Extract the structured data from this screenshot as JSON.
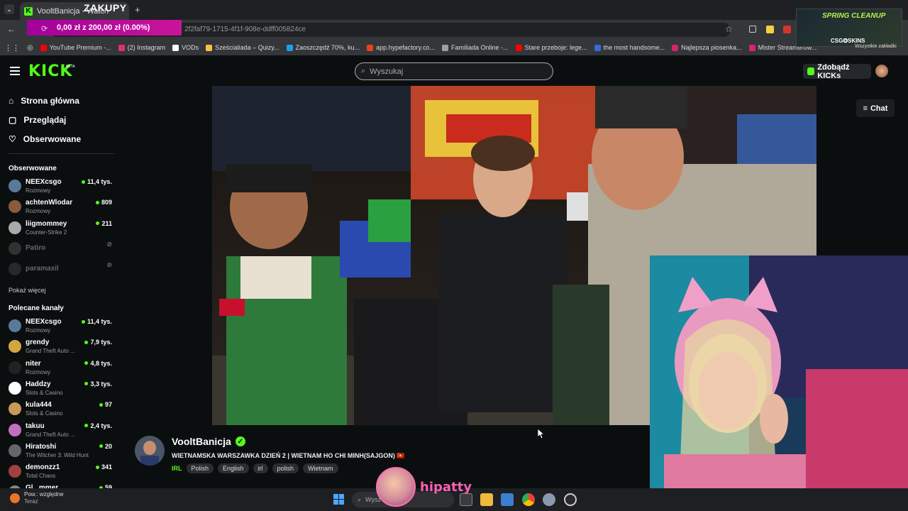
{
  "browser": {
    "tab_title": "VooltBanicja - Watch",
    "tab_overlay": "ZAKUPY",
    "url": "2f2faf79-1715-4f1f-908e-ddff005824ce",
    "donation": "0,00 zł z 200,00 zł (0.00%)",
    "bookmarks": [
      {
        "label": "YouTube Premium -...",
        "color": "#ff0000"
      },
      {
        "label": "(2) Instagram",
        "color": "#e1306c"
      },
      {
        "label": "VODs",
        "color": "#ffffff"
      },
      {
        "label": "Sześcialiada – Quizy...",
        "color": "#f5c542"
      },
      {
        "label": "Zaoszczędź 70%, ku...",
        "color": "#1b9fe8"
      },
      {
        "label": "app.hypefactory.co...",
        "color": "#e8421b"
      },
      {
        "label": "Familiada Online -...",
        "color": "#9aa0a6"
      },
      {
        "label": "Stare przeboje: lege...",
        "color": "#ff0000"
      },
      {
        "label": "the most handsome...",
        "color": "#2f6fd6"
      },
      {
        "label": "Najlepsza piosenka...",
        "color": "#d6246e"
      },
      {
        "label": "Mister Streamerów...",
        "color": "#d6246e"
      }
    ],
    "ad": {
      "line1": "SPRING CLEANUP",
      "line2": "CSG✪SKINS",
      "all_bookmarks": "Wszystkie zakładki"
    }
  },
  "kick": {
    "logo": "KICK",
    "logo_beta": "BETA",
    "search_placeholder": "Wyszukaj",
    "get_kicks": "Zdobądź KICKs",
    "chat_label": "Chat"
  },
  "sidebar": {
    "nav": [
      {
        "label": "Strona główna",
        "icon": "home-icon"
      },
      {
        "label": "Przeglądaj",
        "icon": "browse-icon"
      },
      {
        "label": "Obserwowane",
        "icon": "heart-icon"
      }
    ],
    "followed_title": "Obserwowane",
    "followed": [
      {
        "name": "NEEXcsgo",
        "category": "Rozmowy",
        "viewers": "11,4 tys.",
        "live": true,
        "color": "#5a7a9a"
      },
      {
        "name": "achtenWlodar",
        "category": "Rozmowy",
        "viewers": "809",
        "live": true,
        "color": "#8a5a3a"
      },
      {
        "name": "liigmommey",
        "category": "Counter-Strike 2",
        "viewers": "211",
        "live": true,
        "color": "#aaaaaa"
      },
      {
        "name": "Patiro",
        "category": "",
        "viewers": "",
        "live": false,
        "color": "#555555"
      },
      {
        "name": "paramaxil",
        "category": "",
        "viewers": "",
        "live": false,
        "color": "#444444"
      }
    ],
    "show_more": "Pokaż więcej",
    "recommended_title": "Polecane kanały",
    "recommended": [
      {
        "name": "NEEXcsgo",
        "category": "Rozmowy",
        "viewers": "11,4 tys.",
        "color": "#5a7a9a"
      },
      {
        "name": "grendy",
        "category": "Grand Theft Auto ...",
        "viewers": "7,9 tys.",
        "color": "#d4a640"
      },
      {
        "name": "niter",
        "category": "Rozmowy",
        "viewers": "4,8 tys.",
        "color": "#222222"
      },
      {
        "name": "Haddzy",
        "category": "Slots & Casino",
        "viewers": "3,3 tys.",
        "color": "#ffffff"
      },
      {
        "name": "kula444",
        "category": "Slots & Casino",
        "viewers": "97",
        "color": "#c89a5a"
      },
      {
        "name": "takuu",
        "category": "Grand Theft Auto ...",
        "viewers": "2,4 tys.",
        "color": "#c070c0"
      },
      {
        "name": "Hiratoshi",
        "category": "The Witcher 3: Wild Hunt",
        "viewers": "20",
        "color": "#666666"
      },
      {
        "name": "demonzz1",
        "category": "Total Chaos",
        "viewers": "341",
        "color": "#a04040"
      },
      {
        "name": "Gl...mmer",
        "category": "",
        "viewers": "59",
        "color": "#888888"
      }
    ]
  },
  "stream": {
    "channel": "VooltBanicja",
    "title": "WIETNAMSKA WARSZAWKA DZIEŃ 2 | WIETNAM HO CHI MINH(SAJGON) 🇻🇳",
    "category": "IRL",
    "tags": [
      "Polish",
      "English",
      "irl",
      "polish",
      "Wietnam"
    ]
  },
  "overlay": {
    "name": "hipatty"
  },
  "taskbar": {
    "weather_line1": "Pow.: względne",
    "weather_line2": "Teraz",
    "search_placeholder": "Wysz"
  }
}
